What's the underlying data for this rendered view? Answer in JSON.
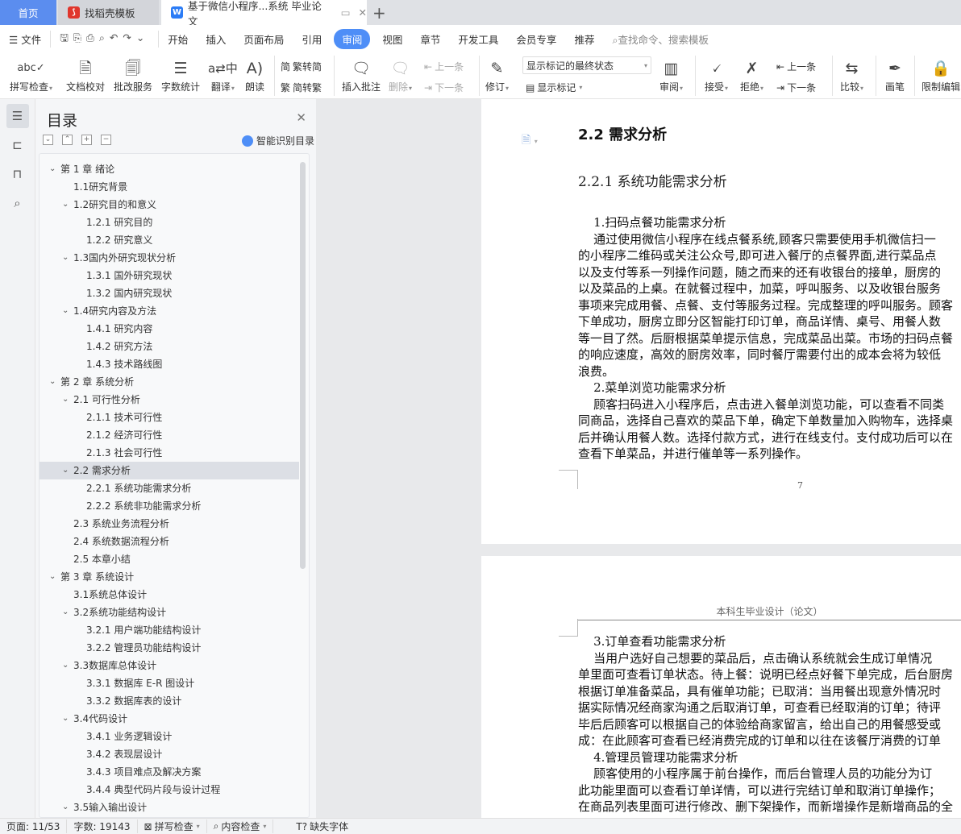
{
  "tabs": [
    {
      "label": "首页"
    },
    {
      "label": "找稻壳模板"
    },
    {
      "label": "基于微信小程序...系统 毕业论文"
    }
  ],
  "menu": {
    "file": "文件",
    "items": [
      "开始",
      "插入",
      "页面布局",
      "引用",
      "审阅",
      "视图",
      "章节",
      "开发工具",
      "会员专享",
      "推荐"
    ],
    "active": "审阅",
    "search_placeholder": "查找命令、搜索模板"
  },
  "ribbon": {
    "spell": "拼写检查",
    "proof": "文档校对",
    "correct": "批改服务",
    "wordcount": "字数统计",
    "translate": "翻译",
    "read": "朗读",
    "t2s": "繁转简",
    "s2t": "简转繁",
    "insert_comment": "插入批注",
    "delete": "删除",
    "prev": "上一条",
    "next": "下一条",
    "revise": "修订",
    "markup_state": "显示标记的最终状态",
    "show_markup": "显示标记",
    "review": "审阅",
    "accept": "接受",
    "reject": "拒绝",
    "prev2": "上一条",
    "next2": "下一条",
    "compare": "比较",
    "pen": "画笔",
    "restrict": "限制编辑"
  },
  "nav": {
    "title": "目录",
    "smart": "智能识别目录",
    "items": [
      {
        "label": "第 1 章  绪论",
        "level": 1,
        "exp": true
      },
      {
        "label": "1.1研究背景",
        "level": 2
      },
      {
        "label": "1.2研究目的和意义",
        "level": 2,
        "exp": true
      },
      {
        "label": "1.2.1 研究目的",
        "level": 3
      },
      {
        "label": "1.2.2 研究意义",
        "level": 3
      },
      {
        "label": "1.3国内外研究现状分析",
        "level": 2,
        "exp": true
      },
      {
        "label": "1.3.1 国外研究现状",
        "level": 3
      },
      {
        "label": "1.3.2 国内研究现状",
        "level": 3
      },
      {
        "label": "1.4研究内容及方法",
        "level": 2,
        "exp": true
      },
      {
        "label": "1.4.1 研究内容",
        "level": 3
      },
      {
        "label": "1.4.2 研究方法",
        "level": 3
      },
      {
        "label": "1.4.3 技术路线图",
        "level": 3
      },
      {
        "label": "第 2 章  系统分析",
        "level": 1,
        "exp": true
      },
      {
        "label": "2.1 可行性分析",
        "level": 2,
        "exp": true
      },
      {
        "label": "2.1.1 技术可行性",
        "level": 3
      },
      {
        "label": "2.1.2 经济可行性",
        "level": 3
      },
      {
        "label": "2.1.3 社会可行性",
        "level": 3
      },
      {
        "label": "2.2 需求分析",
        "level": 2,
        "exp": true,
        "selected": true
      },
      {
        "label": "2.2.1 系统功能需求分析",
        "level": 3
      },
      {
        "label": "2.2.2 系统非功能需求分析",
        "level": 3
      },
      {
        "label": "2.3 系统业务流程分析",
        "level": 2
      },
      {
        "label": "2.4 系统数据流程分析",
        "level": 2
      },
      {
        "label": "2.5 本章小结",
        "level": 2
      },
      {
        "label": "第 3 章  系统设计",
        "level": 1,
        "exp": true
      },
      {
        "label": "3.1系统总体设计",
        "level": 2
      },
      {
        "label": "3.2系统功能结构设计",
        "level": 2,
        "exp": true
      },
      {
        "label": "3.2.1 用户端功能结构设计",
        "level": 3
      },
      {
        "label": "3.2.2 管理员功能结构设计",
        "level": 3
      },
      {
        "label": "3.3数据库总体设计",
        "level": 2,
        "exp": true
      },
      {
        "label": "3.3.1  数据库 E-R 图设计",
        "level": 3
      },
      {
        "label": "3.3.2  数据库表的设计",
        "level": 3
      },
      {
        "label": "3.4代码设计",
        "level": 2,
        "exp": true
      },
      {
        "label": "3.4.1 业务逻辑设计",
        "level": 3
      },
      {
        "label": "3.4.2 表现层设计",
        "level": 3
      },
      {
        "label": "3.4.3 项目难点及解决方案",
        "level": 3
      },
      {
        "label": "3.4.4 典型代码片段与设计过程",
        "level": 3
      },
      {
        "label": "3.5输入输出设计",
        "level": 2,
        "exp": true
      }
    ]
  },
  "doc": {
    "h2": "2.2 需求分析",
    "h3": "2.2.1 系统功能需求分析",
    "page1_lines": [
      "    1.扫码点餐功能需求分析",
      "    通过使用微信小程序在线点餐系统,顾客只需要使用手机微信扫一",
      "的小程序二维码或关注公众号,即可进入餐厅的点餐界面,进行菜品点",
      "以及支付等系一列操作问题，随之而来的还有收银台的接单，厨房的",
      "以及菜品的上桌。在就餐过程中，加菜，呼叫服务、以及收银台服务",
      "事项来完成用餐、点餐、支付等服务过程。完成整理的呼叫服务。顾客",
      "下单成功，厨房立即分区智能打印订单，商品详情、桌号、用餐人数",
      "等一目了然。后厨根据菜单提示信息，完成菜品出菜。市场的扫码点餐",
      "的响应速度，高效的厨房效率，同时餐厅需要付出的成本会将为较低",
      "浪费。",
      "    2.菜单浏览功能需求分析",
      "    顾客扫码进入小程序后，点击进入餐单浏览功能，可以查看不同类",
      "同商品，选择自己喜欢的菜品下单，确定下单数量加入购物车，选择桌",
      "后并确认用餐人数。选择付款方式，进行在线支付。支付成功后可以在",
      "查看下单菜品，并进行催单等一系列操作。"
    ],
    "page_number": "7",
    "header": "本科生毕业设计（论文）",
    "page2_lines": [
      "    3.订单查看功能需求分析",
      "    当用户选好自己想要的菜品后，点击确认系统就会生成订单情况",
      "单里面可查看订单状态。待上餐：说明已经点好餐下单完成，后台厨房",
      "根据订单准备菜品，具有催单功能；已取消：当用餐出现意外情况时",
      "据实际情况经商家沟通之后取消订单，可查看已经取消的订单；待评",
      "毕后后顾客可以根据自己的体验给商家留言，给出自己的用餐感受或",
      "成：在此顾客可查看已经消费完成的订单和以往在该餐厅消费的订单",
      "    4.管理员管理功能需求分析",
      "    顾客使用的小程序属于前台操作，而后台管理人员的功能分为订",
      "此功能里面可以查看订单详情，可以进行完结订单和取消订单操作；",
      "在商品列表里面可进行修改、删下架操作，而新增操作是新增商品的全"
    ]
  },
  "status": {
    "page": "页面: 11/53",
    "words": "字数: 19143",
    "spell": "拼写检查",
    "content": "内容检查",
    "font": "缺失字体"
  },
  "colors": {
    "accent": "#4e8ef7"
  }
}
